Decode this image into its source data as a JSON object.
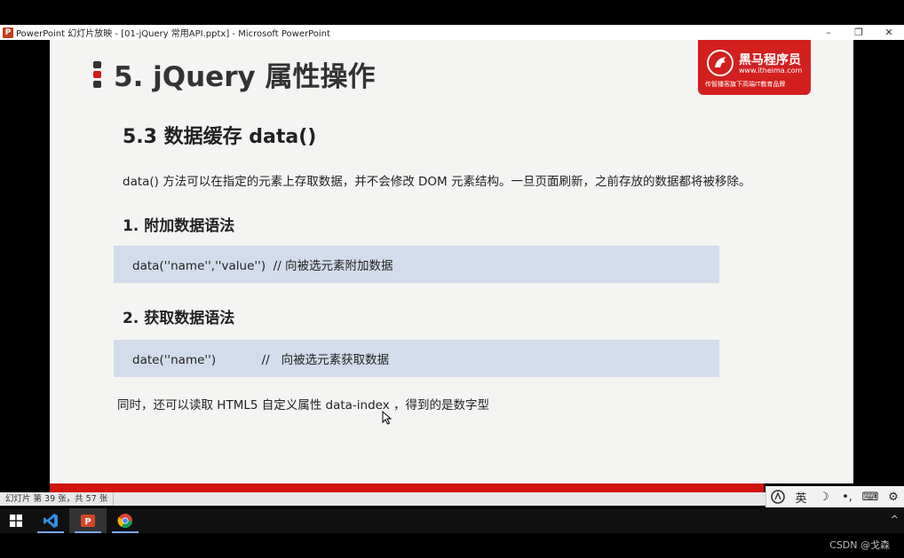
{
  "window": {
    "app_icon_letter": "P",
    "title": "PowerPoint 幻灯片放映 - [01-jQuery 常用API.pptx] - Microsoft PowerPoint",
    "controls": {
      "minimize": "–",
      "restore": "❐",
      "close": "✕"
    }
  },
  "slide": {
    "title": "5. jQuery 属性操作",
    "logo": {
      "name": "黑马程序员",
      "url": "www.itheima.com",
      "slogan": "传智播客旗下高端IT教育品牌"
    },
    "section_title": "5.3  数据缓存 data()",
    "description": "data() 方法可以在指定的元素上存取数据，并不会修改 DOM 元素结构。一旦页面刷新，之前存放的数据都将被移除。",
    "sub1": "1. 附加数据语法",
    "code1": "data(''name'',''value'')  // 向被选元素附加数据",
    "sub2": "2. 获取数据语法",
    "code2": "date(''name'')            //   向被选元素获取数据",
    "note": "同时，还可以读取 HTML5 自定义属性  data-index ，得到的是数字型"
  },
  "statusbar": {
    "slide_info": "幻灯片 第 39 张，共 57 张"
  },
  "ime": {
    "mode": "英",
    "moon": "☽",
    "punct": "•,",
    "keyboard": "⌨",
    "settings": "⚙"
  },
  "taskbar": {
    "apps": [
      {
        "name": "vscode-icon"
      },
      {
        "name": "powerpoint-icon"
      },
      {
        "name": "chrome-icon"
      }
    ],
    "tray_chevron": "^"
  },
  "watermark": "CSDN @戈森",
  "colors": {
    "accent_red": "#d0140e",
    "code_bg": "#d3dcec",
    "slide_bg": "#f4f5f3"
  }
}
